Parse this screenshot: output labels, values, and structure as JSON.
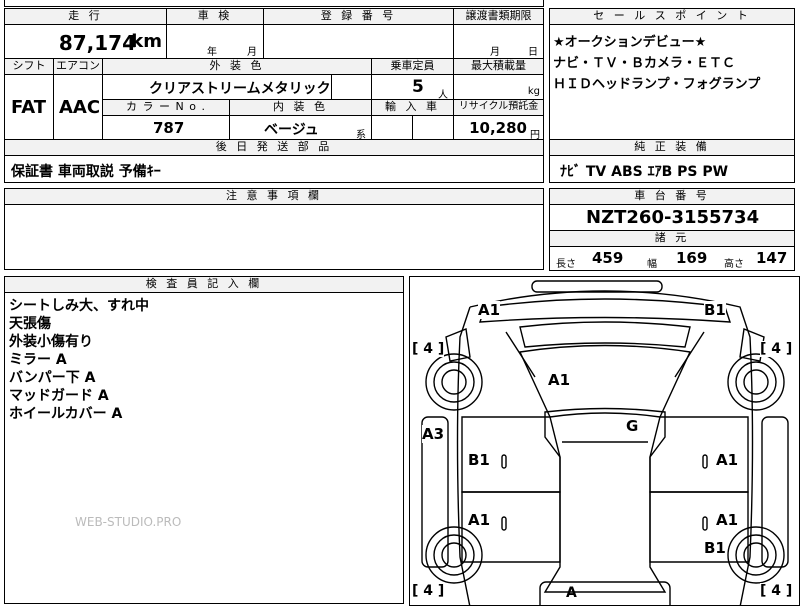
{
  "sheet": {
    "top_row": {
      "mileage_label": "走 行",
      "mileage_value": "87,174",
      "mileage_unit": "km",
      "inspection_label": "車 検",
      "inspection_year_unit": "年",
      "inspection_month_unit": "月",
      "registration_label": "登 録 番 号",
      "transfer_deadline_label": "譲渡書類期限",
      "transfer_month_unit": "月",
      "transfer_day_unit": "日"
    },
    "second_row": {
      "shift_label": "シフト",
      "shift_value": "FAT",
      "aircon_label": "エアコン",
      "aircon_value": "AAC",
      "exterior_color_label": "外 装 色",
      "exterior_color_value": "クリアストリームメタリック",
      "capacity_label": "乗車定員",
      "capacity_value": "5",
      "capacity_unit": "人",
      "max_load_label": "最大積載量",
      "max_load_unit": "kg",
      "color_no_label": "カ ラ ー N o .",
      "color_no_value": "787",
      "interior_color_label": "内 装 色",
      "interior_color_value": "ベージュ",
      "interior_color_suffix": "系",
      "import_label": "輸 入 車",
      "recycle_label": "リサイクル預託金",
      "recycle_value": "10,280",
      "recycle_unit": "円"
    },
    "post_shipping": {
      "label": "後 日 発 送 部 品",
      "value": "保証書  車両取説  予備ｷｰ"
    },
    "sales_points": {
      "label": "セ ー ル ス ポ イ ン ト",
      "lines": [
        "★オークションデビュー★",
        "ナビ・ＴＶ・Ｂカメラ・ＥＴＣ",
        "ＨＩＤヘッドランプ・フォグランプ"
      ]
    },
    "genuine_equipment": {
      "label": "純 正 装 備",
      "value": "ﾅﾋﾞ  TV  ABS  ｴｱB  PS  PW"
    },
    "notes": {
      "label": "注 意 事 項 欄"
    },
    "chassis": {
      "label": "車 台 番 号",
      "value": "NZT260-3155734"
    },
    "dimensions": {
      "label": "諸 元",
      "length_label": "長さ",
      "length_value": "459",
      "width_label": "幅",
      "width_value": "169",
      "height_label": "高さ",
      "height_value": "147"
    },
    "inspector": {
      "label": "検 査 員 記 入 欄",
      "lines": [
        "シートしみ大、すれ中",
        "天張傷",
        "外装小傷有り",
        "ミラー A",
        "バンパー下 A",
        "マッドガード A",
        "ホイールカバー A"
      ]
    },
    "watermark": "WEB-STUDIO.PRO"
  },
  "diagram": {
    "marks": [
      "A1",
      "B1",
      "A1",
      "G",
      "A3",
      "B1",
      "A1",
      "A1",
      "A1",
      "B1",
      "A"
    ],
    "tire_depths": [
      "[ 4 ]",
      "[ 4 ]",
      "[ 4 ]",
      "[ 4 ]"
    ]
  },
  "colors": {
    "header_bg": "#f2f2f2",
    "line": "#000000"
  }
}
